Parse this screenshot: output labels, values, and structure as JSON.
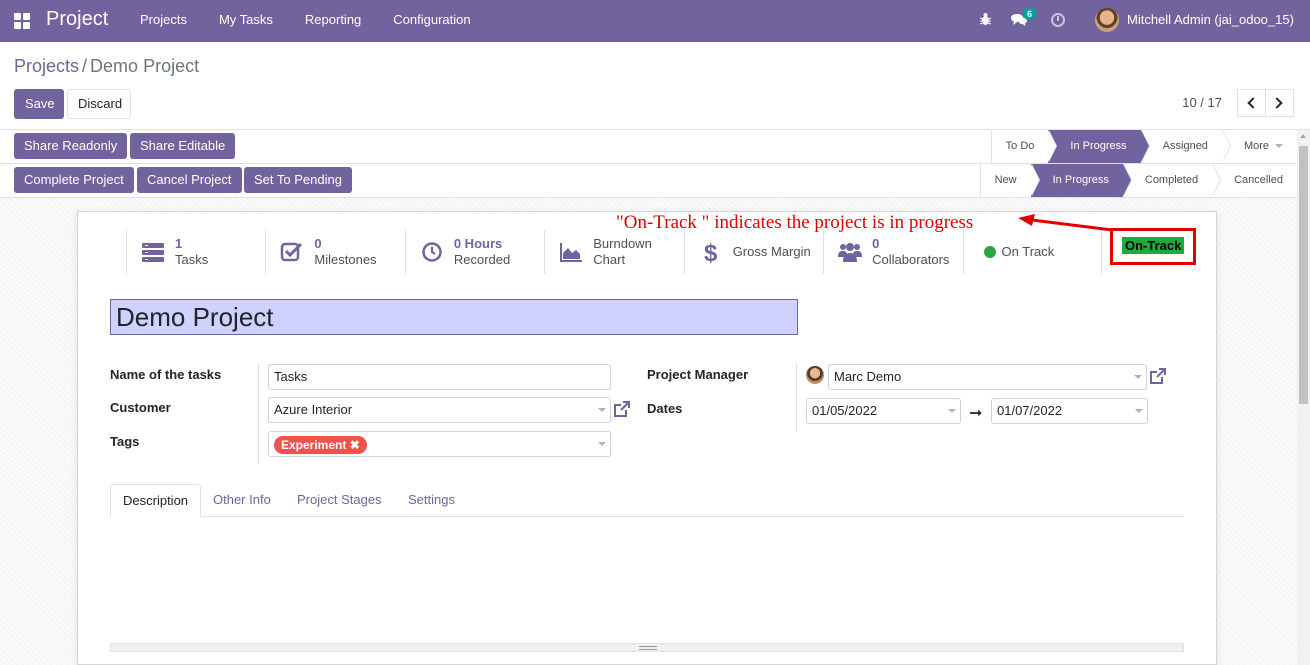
{
  "navbar": {
    "app_title": "Project",
    "menu": [
      "Projects",
      "My Tasks",
      "Reporting",
      "Configuration"
    ],
    "chat_badge": "6",
    "user": "Mitchell Admin (jai_odoo_15)"
  },
  "breadcrumb": {
    "parent": "Projects",
    "separator": "/",
    "current": "Demo Project"
  },
  "actions": {
    "save": "Save",
    "discard": "Discard"
  },
  "pager": {
    "value": "10 / 17"
  },
  "share_buttons": [
    "Share Readonly",
    "Share Editable"
  ],
  "task_stages": [
    "To Do",
    "In Progress",
    "Assigned",
    "More"
  ],
  "task_stage_active": "In Progress",
  "state_buttons": [
    "Complete Project",
    "Cancel Project",
    "Set To Pending"
  ],
  "project_states": [
    "New",
    "In Progress",
    "Completed",
    "Cancelled"
  ],
  "project_state_active": "In Progress",
  "annotation": {
    "text": "\"On-Track \" indicates the project is in progress",
    "color": "#e00000"
  },
  "on_track_label": "On-Track",
  "smart_buttons": [
    {
      "icon": "tasks-icon",
      "value": "1",
      "label": "Tasks"
    },
    {
      "icon": "checkbox-icon",
      "value": "0",
      "label": "Milestones"
    },
    {
      "icon": "clock-icon",
      "value": "0 Hours",
      "label": "Recorded"
    },
    {
      "icon": "area-chart-icon",
      "value": "Burndown",
      "label": "Chart"
    },
    {
      "icon": "dollar-icon",
      "label": "Gross Margin"
    },
    {
      "icon": "users-icon",
      "value": "0",
      "label": "Collaborators"
    },
    {
      "icon": "status-dot-icon",
      "label": "On Track"
    }
  ],
  "project_name": "Demo Project",
  "fields": {
    "name_of_tasks": {
      "label": "Name of the tasks",
      "value": "Tasks"
    },
    "customer": {
      "label": "Customer",
      "value": "Azure Interior"
    },
    "tags": {
      "label": "Tags",
      "value": "Experiment"
    },
    "project_manager": {
      "label": "Project Manager",
      "value": "Marc Demo"
    },
    "dates": {
      "label": "Dates",
      "start": "01/05/2022",
      "end": "01/07/2022"
    }
  },
  "tabs": [
    "Description",
    "Other Info",
    "Project Stages",
    "Settings"
  ],
  "active_tab": "Description",
  "colors": {
    "primary": "#71639e",
    "tag": "#f0524b",
    "on_track": "#1dab3b",
    "title_bg": "#cfd2ff"
  }
}
